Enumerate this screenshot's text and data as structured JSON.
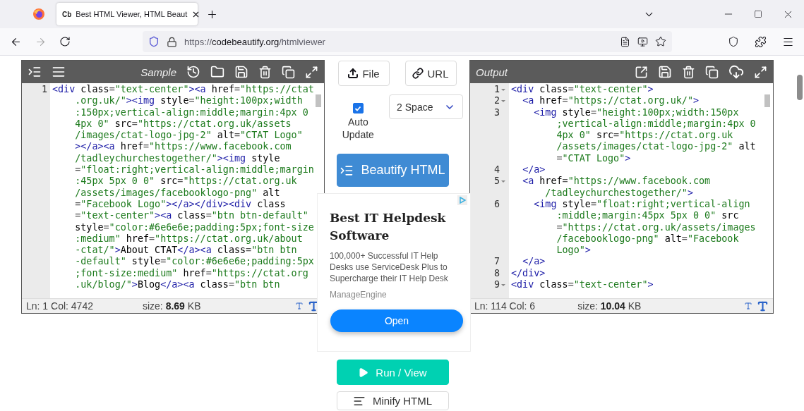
{
  "browser": {
    "tab_title": "Best HTML Viewer, HTML Beaut",
    "tab_favicon": "Cb",
    "url": {
      "scheme": "https://",
      "host": "codebeautify.org",
      "path": "/htmlviewer"
    }
  },
  "input_editor": {
    "title": "Sample",
    "lines": [
      {
        "num": "1",
        "rows": [
          "<div class=\"text-center\"><a href=\"https://ctat",
          ".org.uk/\"><img style=\"height:100px;width",
          ":150px;vertical-align:middle;margin:4px 0",
          "4px 0\" src=\"https://ctat.org.uk/assets",
          "/images/ctat-logo-jpg-2\" alt=\"CTAT Logo\"",
          "></a><a href=\"https://www.facebook.com",
          "/tadleychurchestogether/\"><img style",
          "=\"float:right;vertical-align:middle;margin",
          ":45px 5px 0 0\" src=\"https://ctat.org.uk",
          "/assets/images/facebooklogo-png\" alt",
          "=\"Facebook Logo\"></a></div><div class",
          "=\"text-center\"><a class=\"btn btn-default\"",
          "style=\"color:#6e6e6e;padding:5px;font-size",
          ":medium\" href=\"https://ctat.org.uk/about",
          "-ctat/\">About CTAT</a><a class=\"btn btn",
          "-default\" style=\"color:#6e6e6e;padding:5px",
          ";font-size:medium\" href=\"https://ctat.org",
          ".uk/blog/\">Blog</a><a class=\"btn btn"
        ]
      }
    ],
    "position": "Ln: 1 Col: 4742",
    "size": "size: **8.69** KB"
  },
  "controls": {
    "file_button": "File",
    "url_button": "URL",
    "auto_update": {
      "label": "Auto Update",
      "checked": true
    },
    "indent_select": "2 Space",
    "beautify_button": "Beautify HTML",
    "run_button": "Run / View",
    "minify_button": "Minify HTML"
  },
  "ad": {
    "title": "Best IT Helpdesk Software",
    "body": "100,000+ Successful IT Help Desks use ServiceDesk Plus to Supercharge their IT Help Desk",
    "advertiser": "ManageEngine",
    "button": "Open"
  },
  "output_editor": {
    "title": "Output",
    "lines": [
      {
        "num": "1",
        "fold": true,
        "rows": [
          "<div class=\"text-center\">"
        ]
      },
      {
        "num": "2",
        "fold": true,
        "rows": [
          "  <a href=\"https://ctat.org.uk/\">"
        ]
      },
      {
        "num": "3",
        "fold": false,
        "rows": [
          "    <img style=\"height:100px;width:150px",
          ";vertical-align:middle;margin:4px 0",
          "4px 0\" src=\"https://ctat.org.uk",
          "/assets/images/ctat-logo-jpg-2\" alt",
          "=\"CTAT Logo\">"
        ]
      },
      {
        "num": "4",
        "fold": false,
        "rows": [
          "  </a>"
        ]
      },
      {
        "num": "5",
        "fold": true,
        "rows": [
          "  <a href=\"https://www.facebook.com",
          "/tadleychurchestogether/\">"
        ]
      },
      {
        "num": "6",
        "fold": false,
        "rows": [
          "    <img style=\"float:right;vertical-align",
          ":middle;margin:45px 5px 0 0\" src",
          "=\"https://ctat.org.uk/assets/images",
          "/facebooklogo-png\" alt=\"Facebook",
          "Logo\">"
        ]
      },
      {
        "num": "7",
        "fold": false,
        "rows": [
          "  </a>"
        ]
      },
      {
        "num": "8",
        "fold": false,
        "rows": [
          "</div>"
        ]
      },
      {
        "num": "9",
        "fold": true,
        "rows": [
          "<div class=\"text-center\">"
        ]
      }
    ],
    "position": "Ln: 114 Col: 6",
    "size": "size: **10.04** KB"
  }
}
